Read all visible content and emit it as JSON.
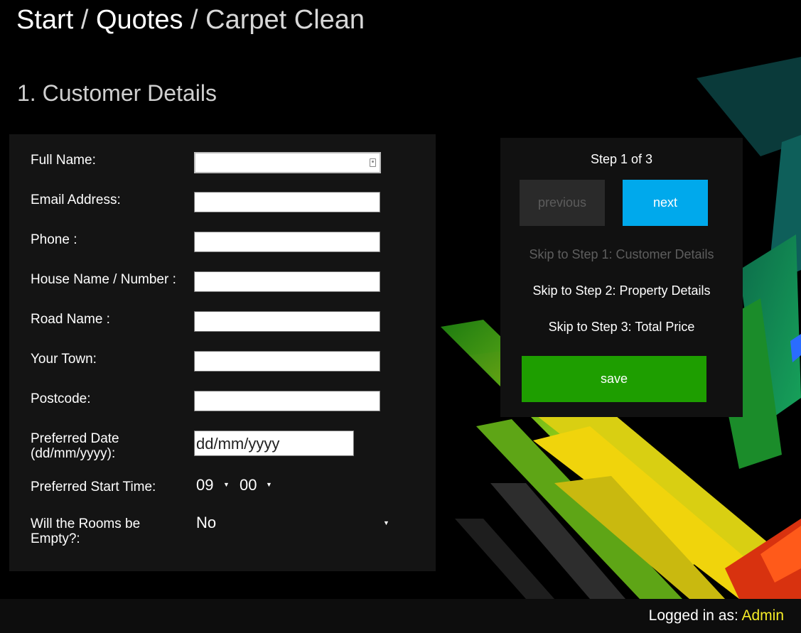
{
  "breadcrumb": {
    "start": "Start",
    "quotes": "Quotes",
    "current": "Carpet Clean",
    "separator": "/"
  },
  "section_title": "1. Customer Details",
  "form": {
    "fields": [
      {
        "label": "Full Name:",
        "value": ""
      },
      {
        "label": "Email Address:",
        "value": ""
      },
      {
        "label": "Phone :",
        "value": ""
      },
      {
        "label": "House Name / Number :",
        "value": ""
      },
      {
        "label": "Road Name :",
        "value": ""
      },
      {
        "label": "Your Town:",
        "value": ""
      },
      {
        "label": "Postcode:",
        "value": ""
      }
    ],
    "preferred_date": {
      "label_line1": "Preferred Date",
      "label_line2": "(dd/mm/yyyy):",
      "placeholder": "dd/mm/yyyy"
    },
    "start_time": {
      "label": "Preferred Start Time:",
      "hour": "09",
      "minute": "00"
    },
    "rooms_empty": {
      "label_line1": "Will the Rooms be",
      "label_line2": "Empty?:",
      "value": "No"
    }
  },
  "wizard": {
    "step_indicator": "Step 1 of 3",
    "previous_label": "previous",
    "next_label": "next",
    "skip_1": "Skip to Step 1: Customer Details",
    "skip_2": "Skip to Step 2: Property Details",
    "skip_3": "Skip to Step 3: Total Price",
    "save_label": "save"
  },
  "footer": {
    "logged_in_prefix": "Logged in as:",
    "user": "Admin"
  },
  "colors": {
    "next_button": "#00a9ec",
    "save_button": "#1e9e00",
    "user_highlight": "#f5ec27",
    "panel_bg": "#141414"
  }
}
